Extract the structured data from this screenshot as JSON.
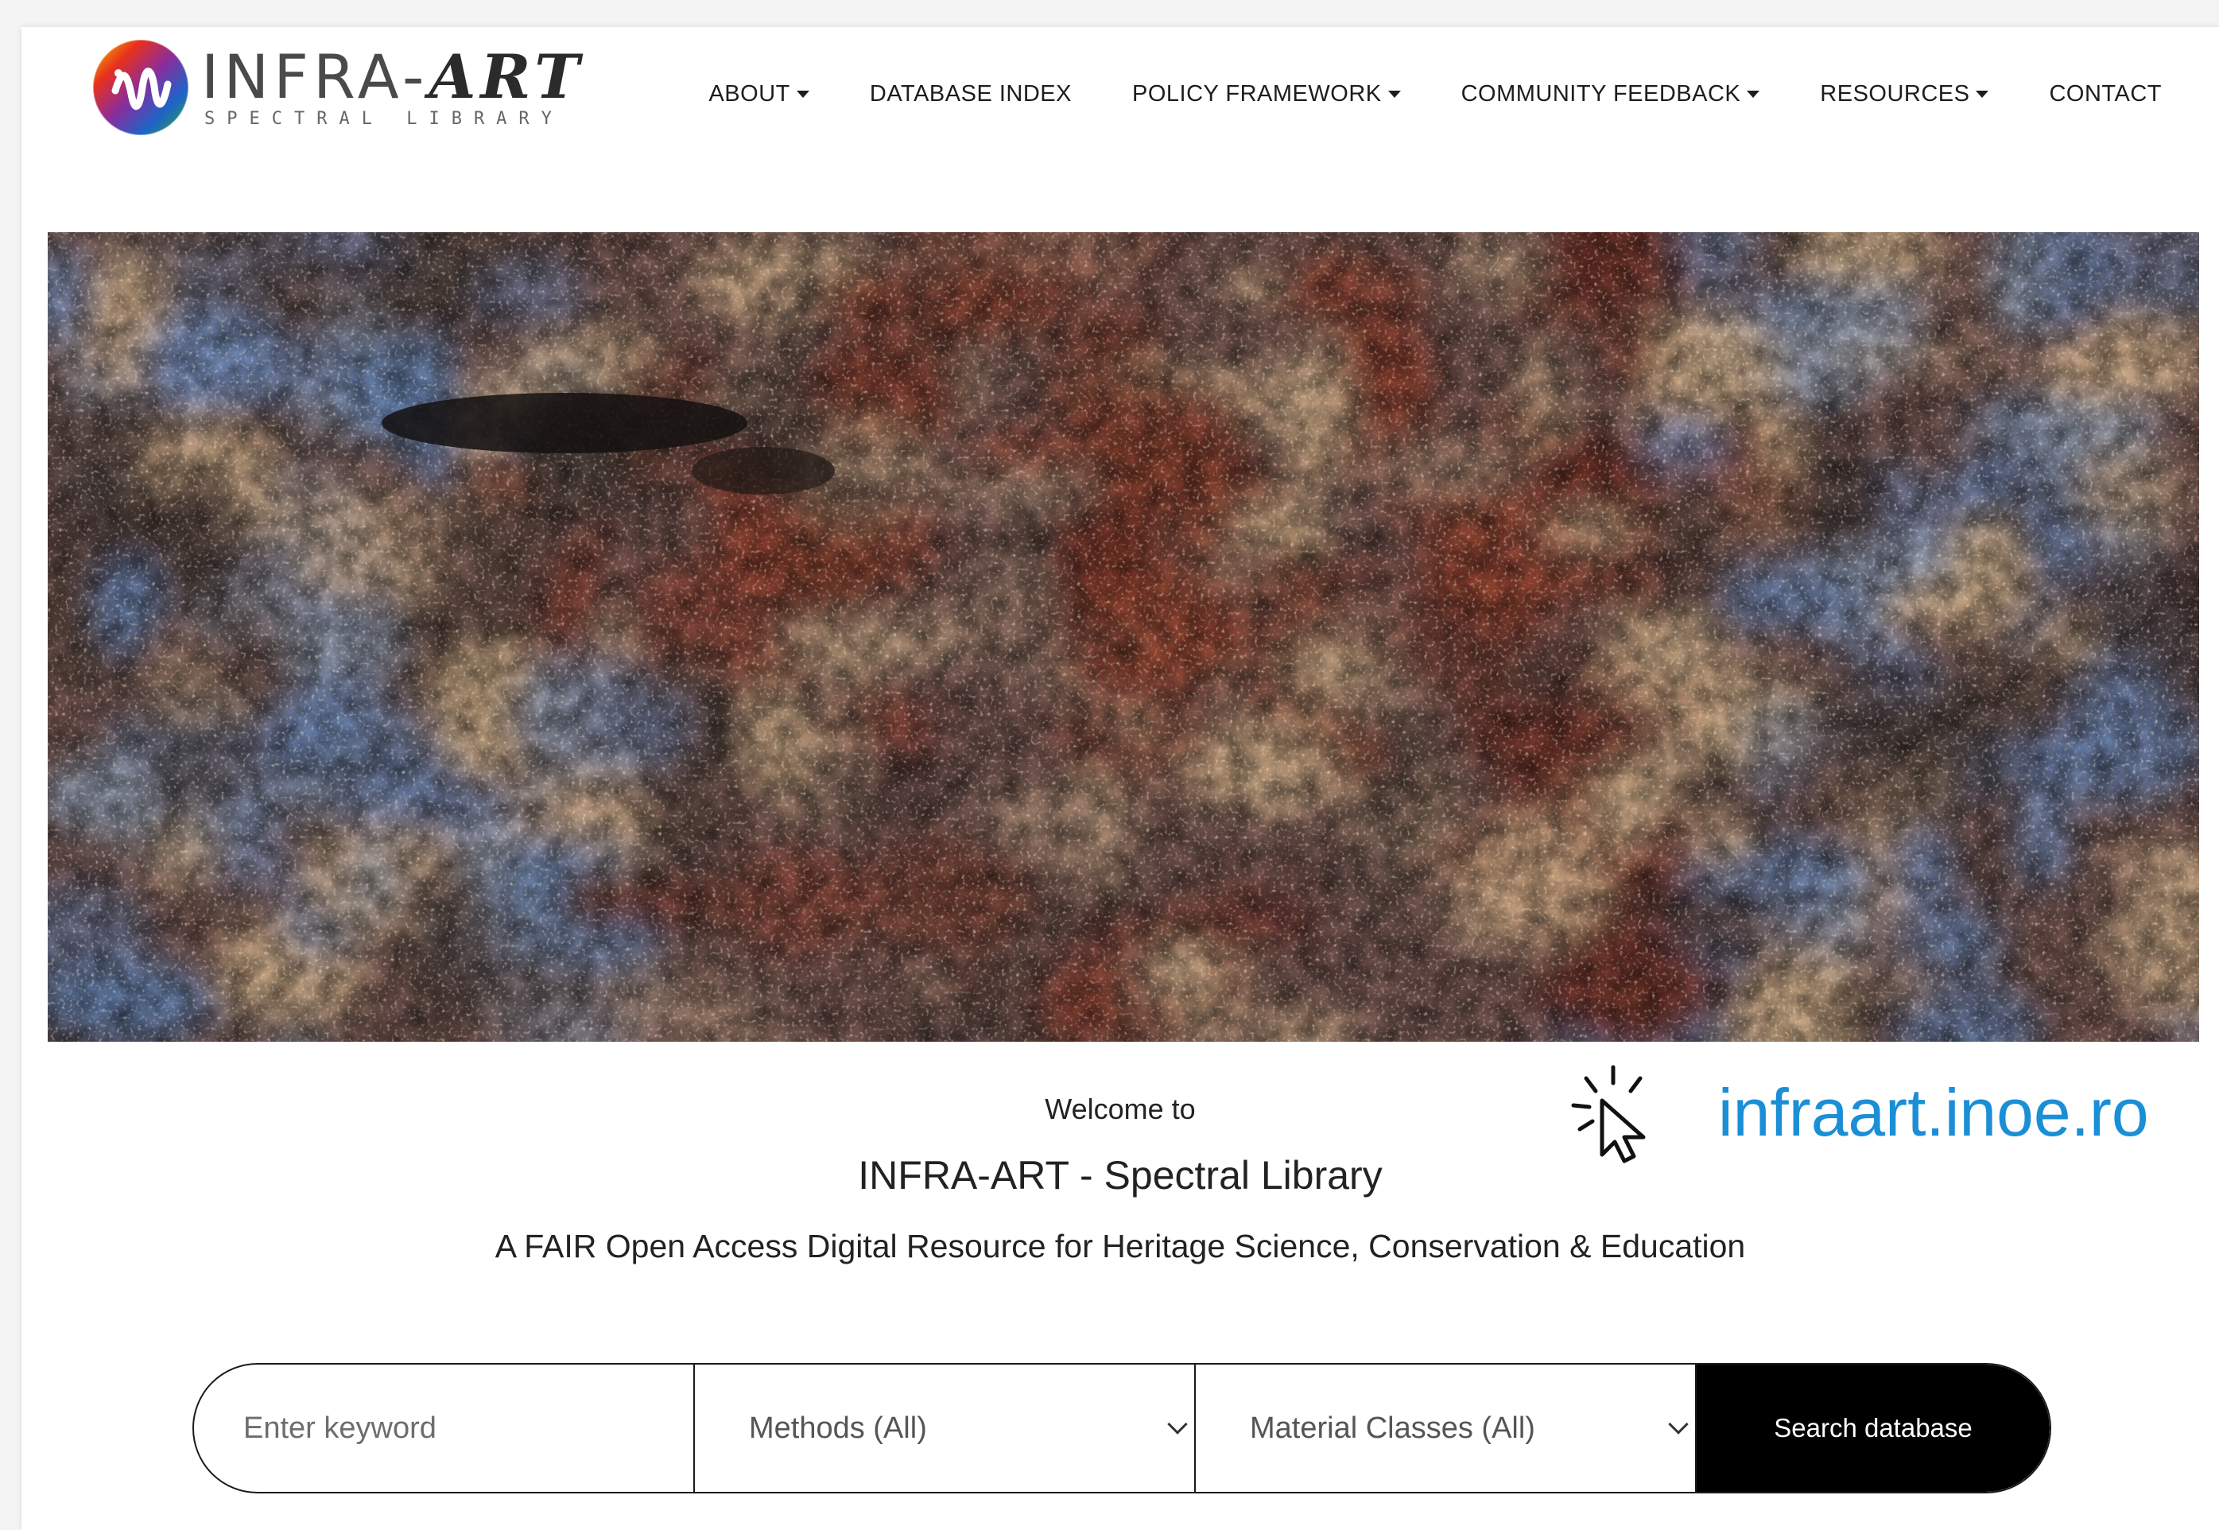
{
  "brand": {
    "name_prefix": "INFRA-",
    "name_suffix": "ART",
    "subtitle": "SPECTRAL LIBRARY"
  },
  "nav": {
    "items": [
      {
        "label": "ABOUT",
        "has_dropdown": true
      },
      {
        "label": "DATABASE INDEX",
        "has_dropdown": false
      },
      {
        "label": "POLICY FRAMEWORK",
        "has_dropdown": true
      },
      {
        "label": "COMMUNITY FEEDBACK",
        "has_dropdown": true
      },
      {
        "label": "RESOURCES",
        "has_dropdown": true
      },
      {
        "label": "CONTACT",
        "has_dropdown": false
      }
    ]
  },
  "hero": {
    "welcome": "Welcome to",
    "title": "INFRA-ART - Spectral Library",
    "tagline": "A FAIR Open Access Digital Resource for Heritage Science, Conservation & Education"
  },
  "callout": {
    "url": "infraart.inoe.ro",
    "icon": "click-cursor-icon",
    "color": "#1a8fd6"
  },
  "search": {
    "keyword_placeholder": "Enter keyword",
    "keyword_value": "",
    "methods_selected": "Methods (All)",
    "materials_selected": "Material Classes (All)",
    "button_label": "Search database"
  }
}
